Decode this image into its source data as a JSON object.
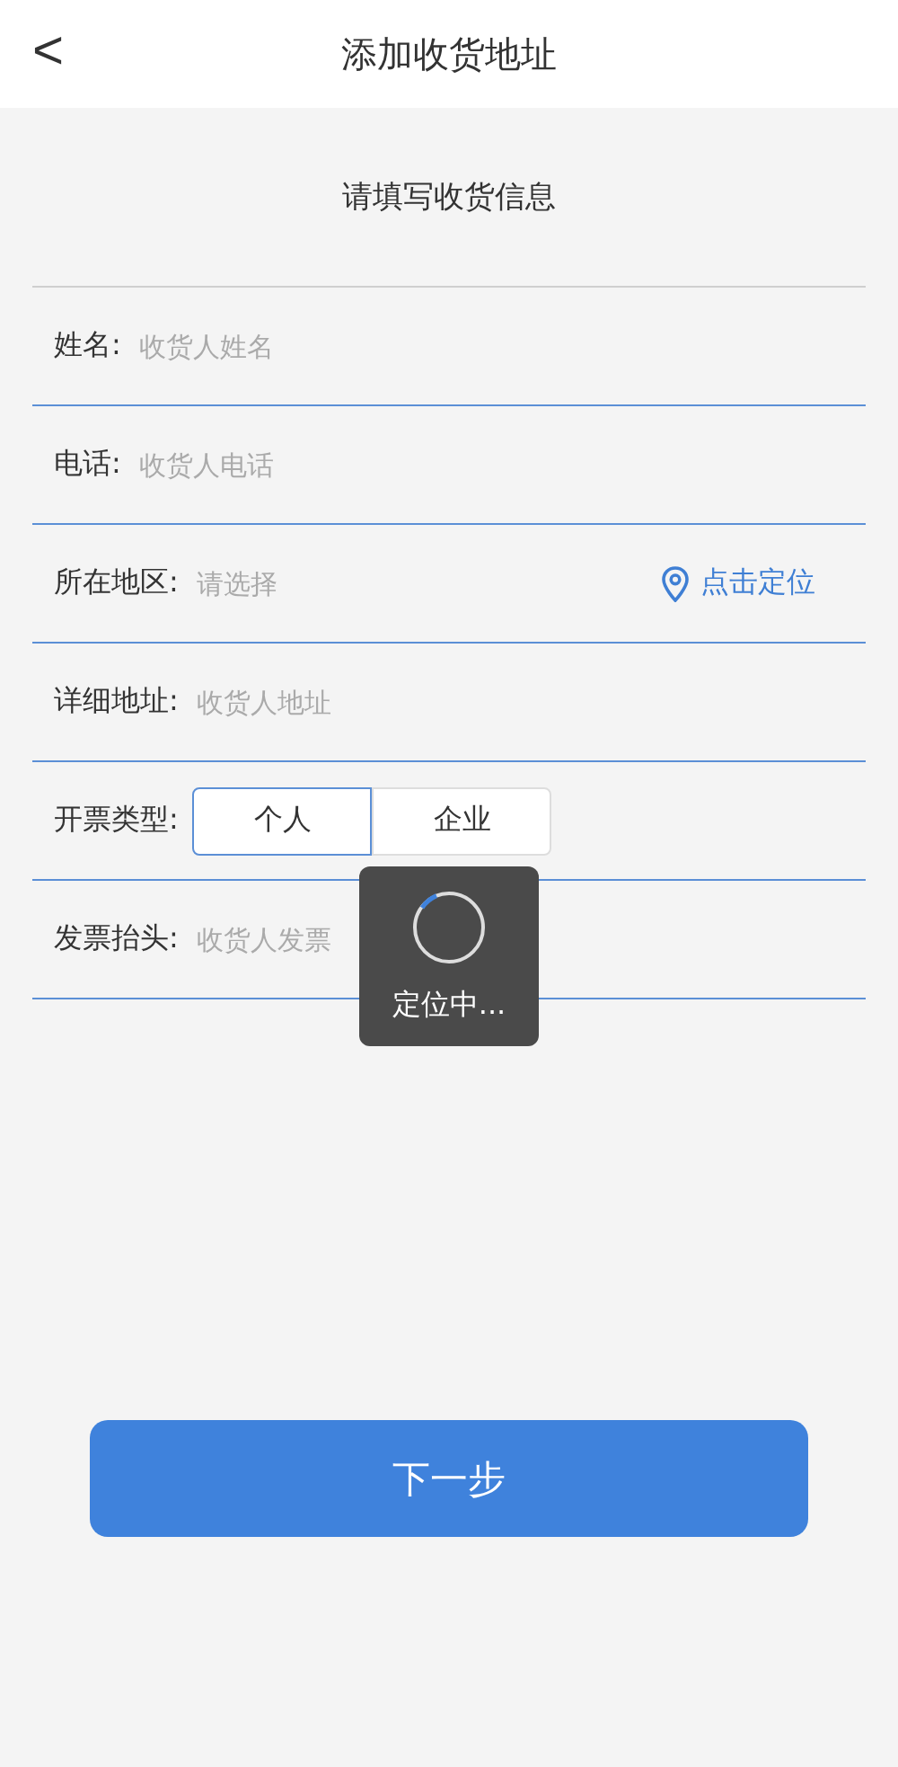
{
  "header": {
    "back": "<",
    "title": "添加收货地址"
  },
  "subtitle": "请填写收货信息",
  "fields": [
    {
      "kind": "input",
      "label": "姓名:",
      "placeholder": "收货人姓名"
    },
    {
      "kind": "input",
      "label": "电话:",
      "placeholder": "收货人电话"
    },
    {
      "kind": "locate",
      "label": "所在地区:",
      "placeholder": "请选择",
      "action": "点击定位"
    },
    {
      "kind": "input",
      "label": "详细地址:",
      "placeholder": "收货人地址"
    },
    {
      "kind": "segment",
      "label": "开票类型:",
      "options": [
        {
          "label": "个人",
          "selected": true
        },
        {
          "label": "企业",
          "selected": false
        }
      ]
    },
    {
      "kind": "input",
      "label": "发票抬头:",
      "placeholder": "收货人发票"
    }
  ],
  "next_button": "下一步",
  "toast": {
    "text": "定位中..."
  }
}
